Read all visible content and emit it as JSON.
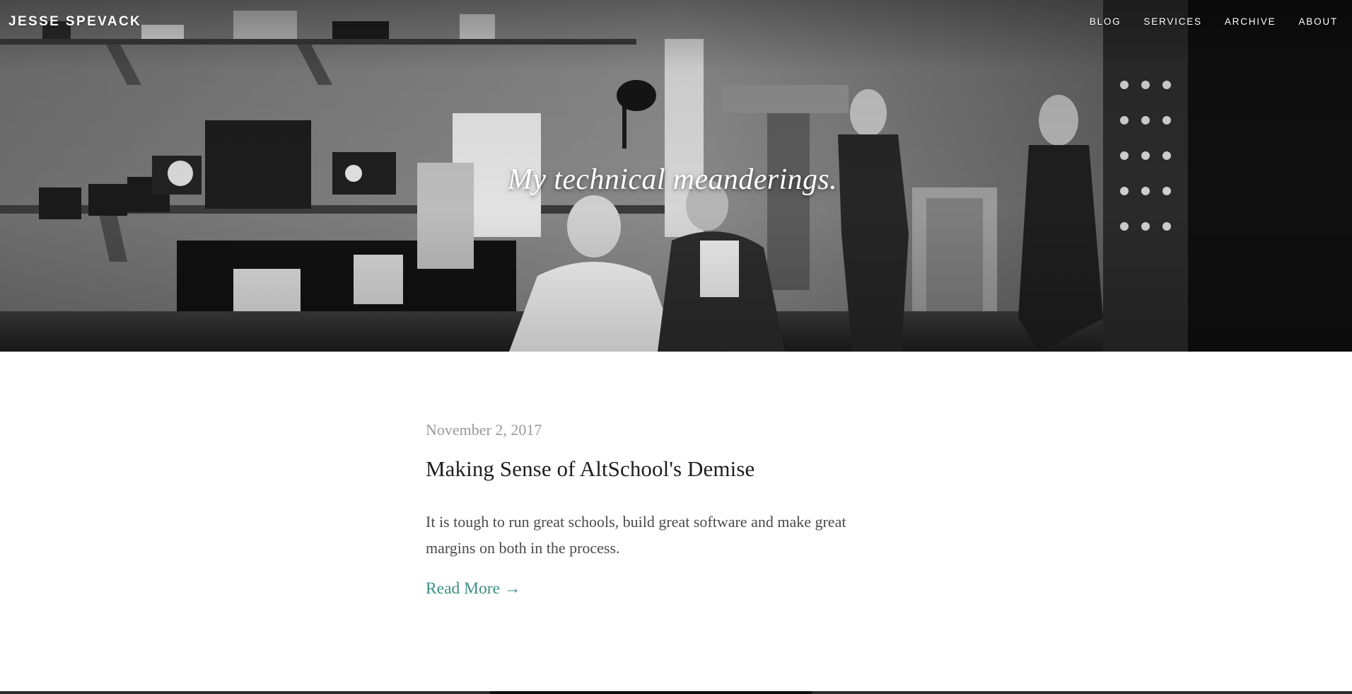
{
  "header": {
    "site_title": "JESSE SPEVACK",
    "nav": [
      {
        "label": "BLOG"
      },
      {
        "label": "SERVICES"
      },
      {
        "label": "ARCHIVE"
      },
      {
        "label": "ABOUT"
      }
    ]
  },
  "hero": {
    "tagline": "My technical meanderings."
  },
  "post": {
    "date": "November 2, 2017",
    "title": "Making Sense of AltSchool's Demise",
    "excerpt": "It is tough to run great schools, build great software and make great margins on both in the process.",
    "read_more": "Read More →"
  },
  "colors": {
    "accent": "#3a8f85",
    "date": "#9a9a9a",
    "title": "#1e1e1e",
    "body": "#4a4a4a"
  }
}
